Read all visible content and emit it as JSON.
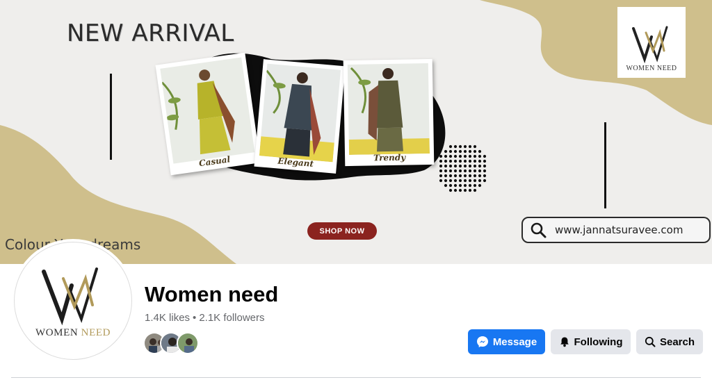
{
  "cover": {
    "headline": "NEW ARRIVAL",
    "tagline": "Colour Your dreams",
    "shop_button": "SHOP NOW",
    "website": "www.jannatsuravee.com",
    "brand_logo_text": "WOMEN NEED",
    "photos": [
      {
        "caption": "Casual"
      },
      {
        "caption": "Elegant"
      },
      {
        "caption": "Trendy"
      }
    ]
  },
  "profile": {
    "avatar_text": {
      "first": "WOMEN",
      "second": "NEED"
    },
    "name": "Women need",
    "likes": "1.4K likes",
    "separator": "•",
    "followers": "2.1K followers",
    "friend_avatars": [
      "friend-1",
      "friend-2",
      "friend-3"
    ]
  },
  "actions": {
    "message_label": "Message",
    "following_label": "Following",
    "search_label": "Search"
  },
  "colors": {
    "primary_blue": "#1877f2",
    "secondary_button": "#e4e6eb",
    "shop_button": "#8b231f",
    "tan_accent": "#cfbf8c"
  },
  "icons": [
    "messenger-icon",
    "bell-icon",
    "search-icon"
  ]
}
